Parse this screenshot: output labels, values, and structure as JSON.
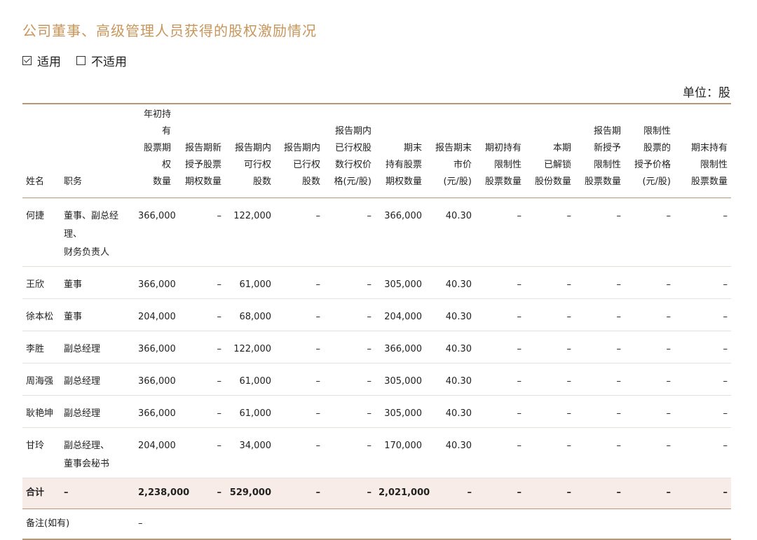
{
  "title": "公司董事、高级管理人员获得的股权激励情况",
  "options": {
    "applicable": "适用",
    "not_applicable": "不适用"
  },
  "unit": "单位：股",
  "table": {
    "headers": [
      "姓名",
      "职务",
      "年初持有\n股票期权\n数量",
      "报告期新\n授予股票\n期权数量",
      "报告期内\n可行权\n股数",
      "报告期内\n已行权\n股数",
      "报告期内\n已行权股\n数行权价\n格(元/股)",
      "期末\n持有股票\n期权数量",
      "报告期末\n市价\n(元/股)",
      "期初持有\n限制性\n股票数量",
      "本期\n已解锁\n股份数量",
      "报告期\n新授予\n限制性\n股票数量",
      "限制性\n股票的\n授予价格\n(元/股)",
      "期末持有\n限制性\n股票数量"
    ],
    "rows": [
      [
        "何捷",
        "董事、副总经理、\n财务负责人",
        "366,000",
        "–",
        "122,000",
        "–",
        "–",
        "366,000",
        "40.30",
        "–",
        "–",
        "–",
        "–",
        "–"
      ],
      [
        "王欣",
        "董事",
        "366,000",
        "–",
        "61,000",
        "–",
        "–",
        "305,000",
        "40.30",
        "–",
        "–",
        "–",
        "–",
        "–"
      ],
      [
        "徐本松",
        "董事",
        "204,000",
        "–",
        "68,000",
        "–",
        "–",
        "204,000",
        "40.30",
        "–",
        "–",
        "–",
        "–",
        "–"
      ],
      [
        "李胜",
        "副总经理",
        "366,000",
        "–",
        "122,000",
        "–",
        "–",
        "366,000",
        "40.30",
        "–",
        "–",
        "–",
        "–",
        "–"
      ],
      [
        "周海强",
        "副总经理",
        "366,000",
        "–",
        "61,000",
        "–",
        "–",
        "305,000",
        "40.30",
        "–",
        "–",
        "–",
        "–",
        "–"
      ],
      [
        "耿艳坤",
        "副总经理",
        "366,000",
        "–",
        "61,000",
        "–",
        "–",
        "305,000",
        "40.30",
        "–",
        "–",
        "–",
        "–",
        "–"
      ],
      [
        "甘玲",
        "副总经理、\n董事会秘书",
        "204,000",
        "–",
        "34,000",
        "–",
        "–",
        "170,000",
        "40.30",
        "–",
        "–",
        "–",
        "–",
        "–"
      ]
    ],
    "total": [
      "合计",
      "–",
      "2,238,000",
      "–",
      "529,000",
      "–",
      "–",
      "2,021,000",
      "–",
      "–",
      "–",
      "–",
      "–",
      "–"
    ],
    "remark": {
      "label": "备注(如有)",
      "value": "–"
    }
  }
}
